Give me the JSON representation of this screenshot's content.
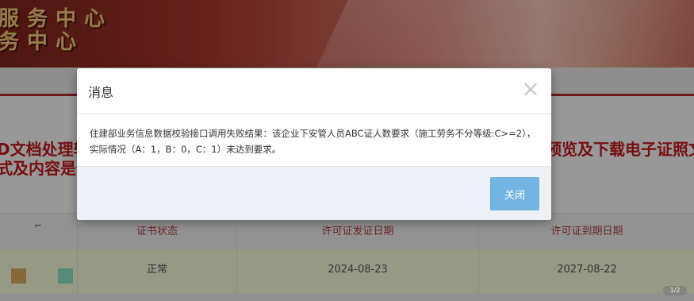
{
  "banner": {
    "line1": "服务中心",
    "line2": "务中心"
  },
  "page_text": {
    "red_line1_left": "D文档处理轨",
    "red_line2_left": "式及内容是否",
    "red_line1_right": "预览及下载电子证照文"
  },
  "table": {
    "corner": "⌐",
    "headers": [
      "证书状态",
      "许可证发证日期",
      "许可证到期日期"
    ],
    "row": {
      "status": "正常",
      "issue_date": "2024-08-23",
      "expiry_date": "2027-08-22"
    },
    "squares": [
      "#d8a85c",
      "#8fdcc0"
    ]
  },
  "modal": {
    "title": "消息",
    "close_icon": "×",
    "message": "住建部业务信息数据校验接口调用失败结果：该企业下安管人员ABC证人数要求（施工劳务不分等级:C>=2），实际情况（A：1，B：0，C：1）未达到要求。",
    "button_label": "关闭"
  },
  "badge": "1/2",
  "colors": {
    "accent_button": "#74b4e2",
    "brand_red": "#c0151b"
  }
}
